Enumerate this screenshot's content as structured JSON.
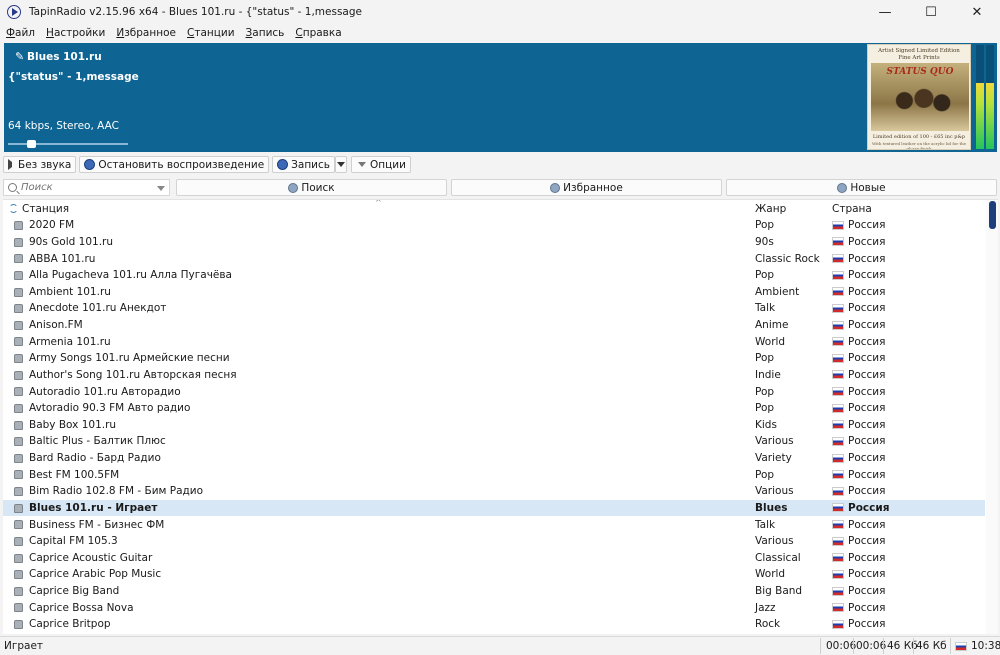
{
  "window": {
    "title": "TapinRadio v2.15.96 x64  -  Blues 101.ru  - {\"status\" - 1,message",
    "controls": {
      "minimize": "—",
      "maximize": "☐",
      "close": "✕"
    }
  },
  "menu": [
    "Файл",
    "Настройки",
    "Избранное",
    "Станции",
    "Запись",
    "Справка"
  ],
  "now_playing": {
    "station": "Blues 101.ru",
    "track": "{\"status\" - 1,message",
    "format": "64 kbps, Stereo, AAC",
    "volume_level": 0.17,
    "cover": {
      "line1": "Artist Signed Limited Edition",
      "line2": "Fine Art Prints",
      "band": "STATUS QUO",
      "foot1": "Limited edition of 100 - £65 inc p&p",
      "foot2": "With textured leather on the acrylic lid for the glossy finish"
    },
    "vu_levels": [
      0.63,
      0.63
    ]
  },
  "toolbar": {
    "mute_label": "Без звука",
    "stop_label": "Остановить воспроизведение",
    "record_label": "Запись",
    "options_label": "Опции"
  },
  "search": {
    "placeholder": "Поиск",
    "tab_search": "Поиск",
    "tab_favorites": "Избранное",
    "tab_new": "Новые"
  },
  "list": {
    "headers": {
      "station": "Станция",
      "genre": "Жанр",
      "country": "Страна"
    },
    "rows": [
      {
        "name": "2020 FM",
        "genre": "Pop",
        "country": "Россия"
      },
      {
        "name": "90s Gold 101.ru",
        "genre": "90s",
        "country": "Россия"
      },
      {
        "name": "ABBA 101.ru",
        "genre": "Classic Rock",
        "country": "Россия"
      },
      {
        "name": "Alla Pugacheva 101.ru Алла Пугачёва",
        "genre": "Pop",
        "country": "Россия"
      },
      {
        "name": "Ambient 101.ru",
        "genre": "Ambient",
        "country": "Россия"
      },
      {
        "name": "Anecdote 101.ru Анекдот",
        "genre": "Talk",
        "country": "Россия"
      },
      {
        "name": "Anison.FM",
        "genre": "Anime",
        "country": "Россия"
      },
      {
        "name": "Armenia 101.ru",
        "genre": "World",
        "country": "Россия"
      },
      {
        "name": "Army Songs 101.ru Армейские песни",
        "genre": "Pop",
        "country": "Россия"
      },
      {
        "name": "Author's Song 101.ru Авторская песня",
        "genre": "Indie",
        "country": "Россия"
      },
      {
        "name": "Autoradio 101.ru Авторадио",
        "genre": "Pop",
        "country": "Россия"
      },
      {
        "name": "Avtoradio 90.3 FM Авто радио",
        "genre": "Pop",
        "country": "Россия"
      },
      {
        "name": "Baby Box 101.ru",
        "genre": "Kids",
        "country": "Россия"
      },
      {
        "name": "Baltic Plus - Балтик Плюс",
        "genre": "Various",
        "country": "Россия"
      },
      {
        "name": "Bard Radio - Бард Радио",
        "genre": "Variety",
        "country": "Россия"
      },
      {
        "name": "Best FM 100.5FM",
        "genre": "Pop",
        "country": "Россия"
      },
      {
        "name": "Bim Radio 102.8 FM - Бим Радио",
        "genre": "Various",
        "country": "Россия"
      },
      {
        "name": "Blues 101.ru - Играет",
        "genre": "Blues",
        "country": "Россия",
        "selected": true
      },
      {
        "name": "Business FM - Бизнес ФМ",
        "genre": "Talk",
        "country": "Россия"
      },
      {
        "name": "Capital FM 105.3",
        "genre": "Various",
        "country": "Россия"
      },
      {
        "name": "Caprice Acoustic Guitar",
        "genre": "Classical",
        "country": "Россия"
      },
      {
        "name": "Caprice Arabic Pop Music",
        "genre": "World",
        "country": "Россия"
      },
      {
        "name": "Caprice Big Band",
        "genre": "Big Band",
        "country": "Россия"
      },
      {
        "name": "Caprice Bossa Nova",
        "genre": "Jazz",
        "country": "Россия"
      },
      {
        "name": "Caprice Britpop",
        "genre": "Rock",
        "country": "Россия"
      }
    ]
  },
  "status": {
    "text": "Играет",
    "time1": "00:06",
    "time2": "00:06",
    "size1": "46 Кб",
    "size2": "46 Кб",
    "clock": "10:38"
  }
}
